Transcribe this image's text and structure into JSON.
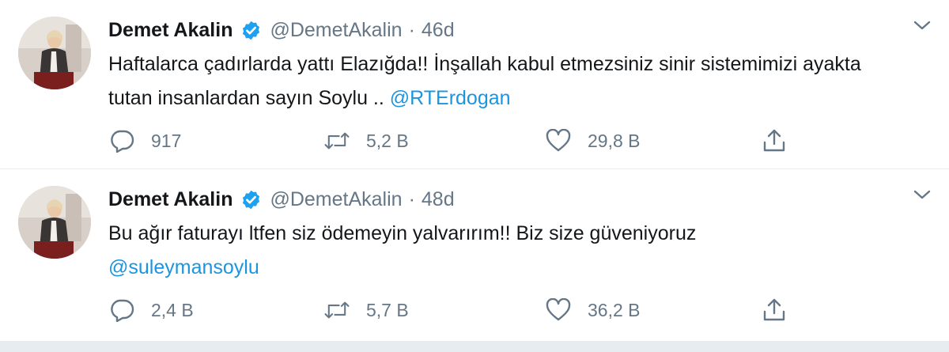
{
  "tweets": [
    {
      "name": "Demet Akalin",
      "handle": "@DemetAkalin",
      "separator": "·",
      "time": "46d",
      "text": "Haftalarca çadırlarda yattı Elazığda!! İnşallah kabul etmezsiniz sinir sistemimizi ayakta tutan insanlardan sayın Soylu .. ",
      "mention": "@RTErdogan",
      "replies": "917",
      "retweets": "5,2 B",
      "likes": "29,8 B"
    },
    {
      "name": "Demet Akalin",
      "handle": "@DemetAkalin",
      "separator": "·",
      "time": "48d",
      "text": "Bu ağır faturayı ltfen siz ödemeyin yalvarırım!! Biz size güveniyoruz ",
      "mention": "@suleymansoylu",
      "replies": "2,4 B",
      "retweets": "5,7 B",
      "likes": "36,2 B"
    }
  ],
  "icons": {
    "verified": "verified-badge-icon",
    "chevron": "chevron-down-icon",
    "reply": "reply-icon",
    "retweet": "retweet-icon",
    "like": "heart-icon",
    "share": "share-icon"
  },
  "colors": {
    "accent": "#1da1f2",
    "mention": "#1b95e0",
    "muted": "#657786",
    "divider": "#e6ecf0"
  }
}
